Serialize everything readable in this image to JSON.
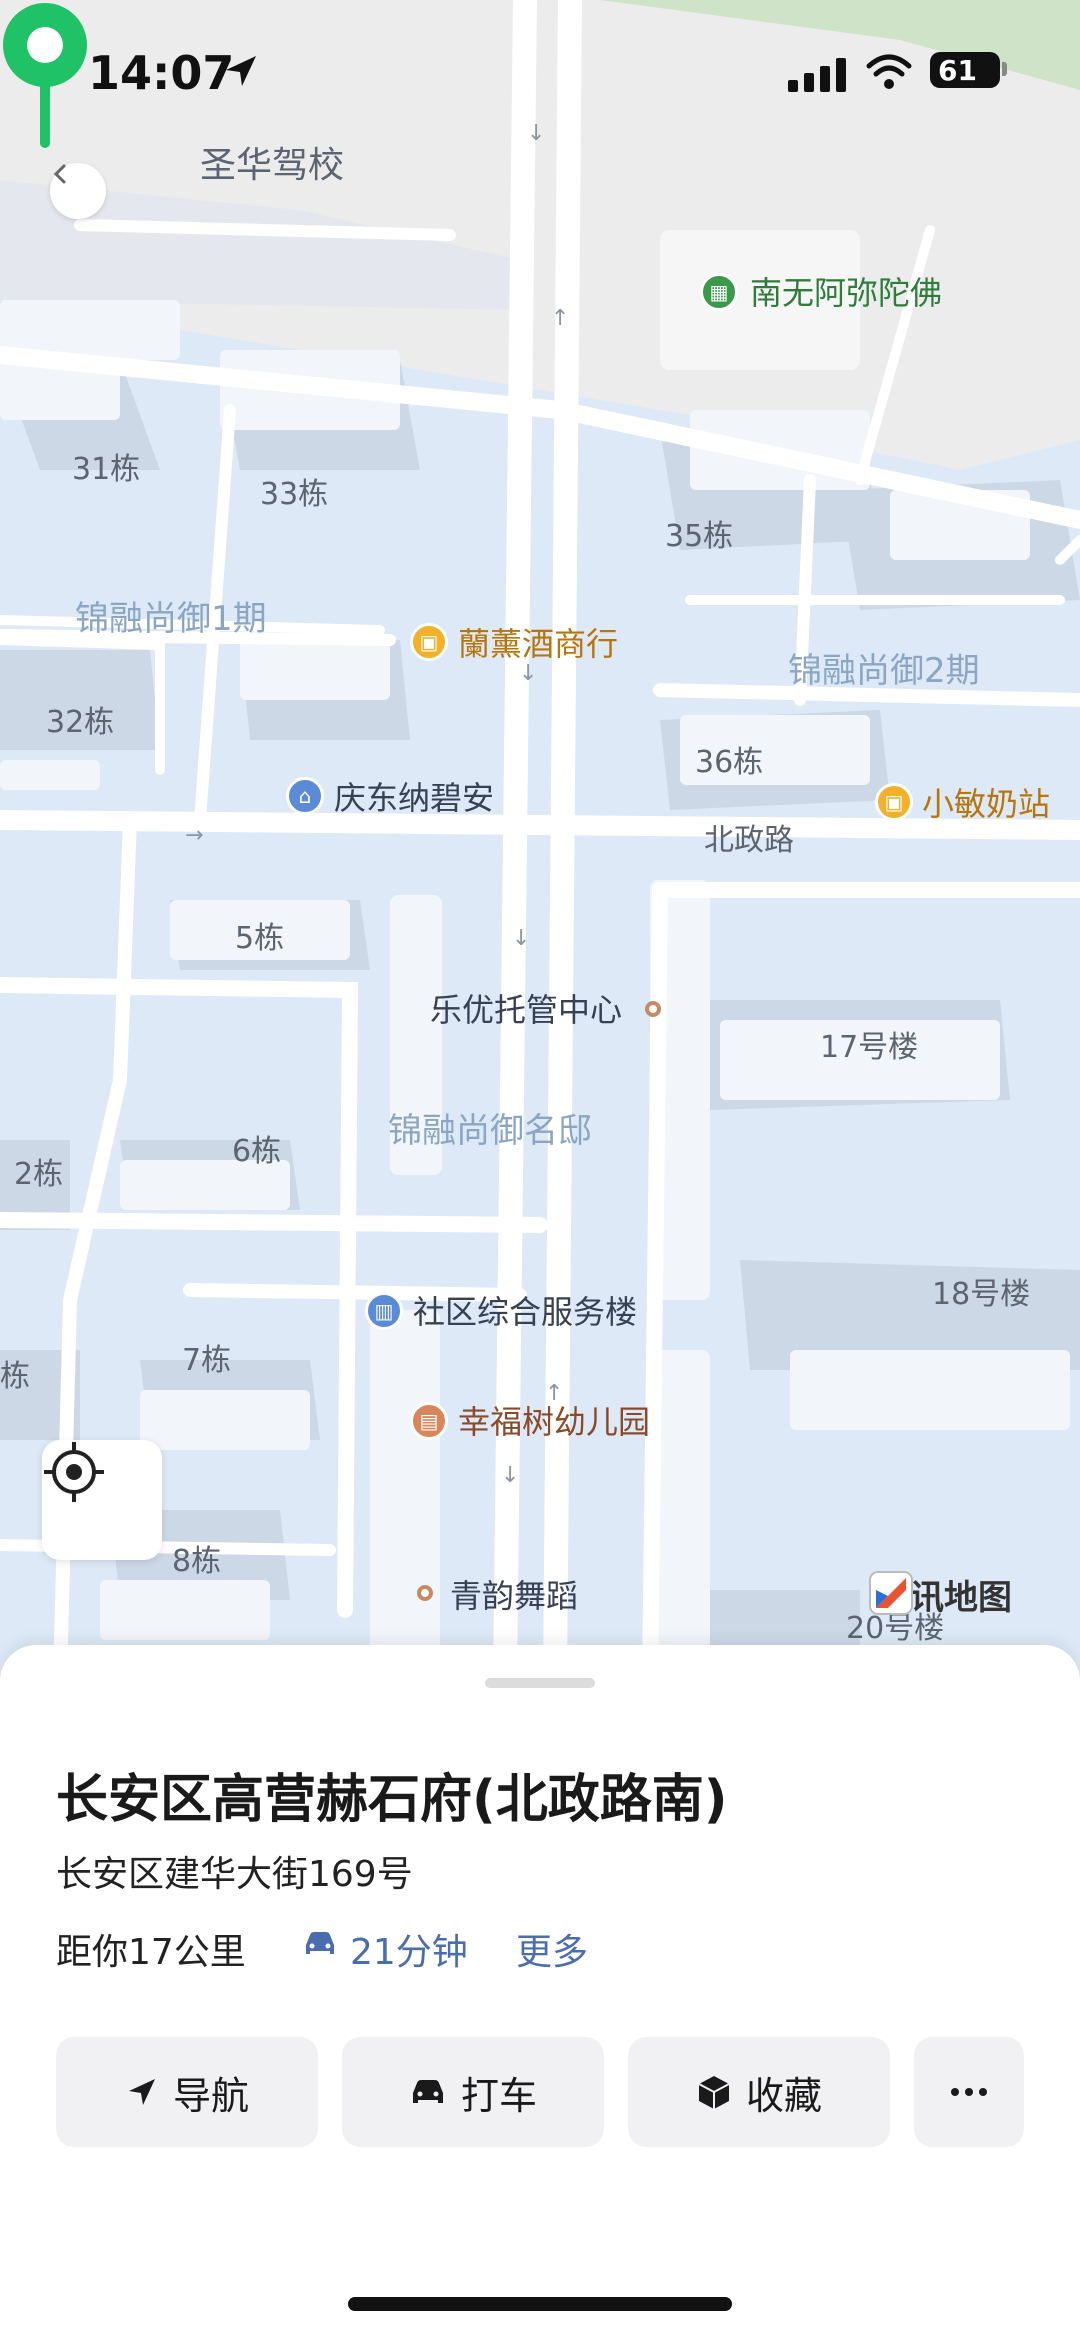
{
  "status_bar": {
    "time": "14:07",
    "battery": "61"
  },
  "map": {
    "labels": {
      "school": "圣华驾校",
      "temple": "南无阿弥陀佛",
      "b31": "31栋",
      "b33": "33栋",
      "b35": "35栋",
      "b32": "32栋",
      "b36": "36栋",
      "b5": "5栋",
      "b6": "6栋",
      "b2": "2栋",
      "b7": "7栋",
      "b8": "8栋",
      "b_edge": "栋",
      "b17": "17号楼",
      "b18": "18号楼",
      "b20": "20号楼",
      "area1": "锦融尚御1期",
      "area2": "锦融尚御2期",
      "area_ming": "锦融尚御名邸",
      "wine": "蘭薰酒商行",
      "milk": "小敏奶站",
      "qingdong": "庆东纳碧安",
      "road": "北政路",
      "tutor": "乐优托管中心",
      "community": "社区综合服务楼",
      "kinder": "幸福树幼儿园",
      "dance": "青韵舞蹈"
    },
    "brand": "腾讯地图",
    "icons": {
      "back": "chevron-left-icon",
      "locate": "crosshair-icon",
      "pin": "map-pin-icon"
    }
  },
  "place": {
    "title": "长安区高营赫石府(北政路南)",
    "address": "长安区建华大街169号",
    "distance": "距你17公里",
    "drive_time": "21分钟",
    "more": "更多"
  },
  "actions": {
    "navigate": "导航",
    "taxi": "打车",
    "favorite": "收藏"
  },
  "colors": {
    "pin": "#1fc266",
    "link": "#4a6cb0",
    "map_bg": "#dde9f6",
    "area_label": "#8aa6c4",
    "poi_orange": "#f3b12b"
  }
}
